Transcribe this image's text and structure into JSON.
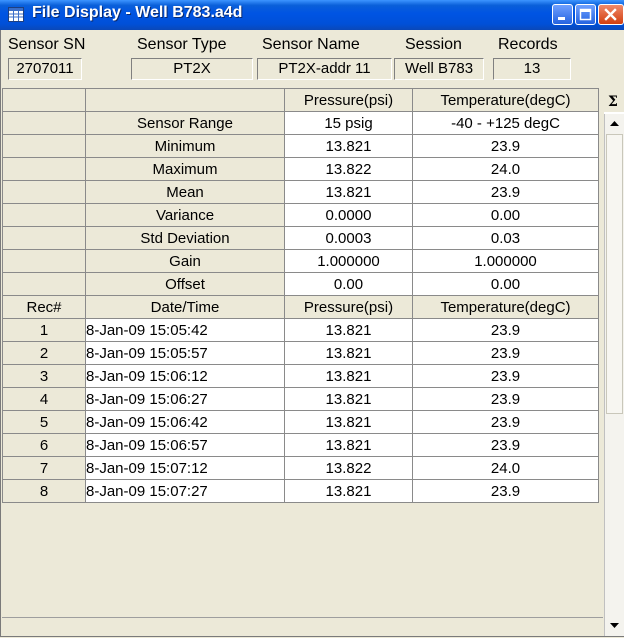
{
  "window": {
    "title": "File Display - Well B783.a4d",
    "icon": "grid-window-icon",
    "buttons": [
      "minimize-icon",
      "maximize-icon",
      "close-icon"
    ]
  },
  "header": {
    "labels": [
      "Sensor SN",
      "Sensor Type",
      "Sensor Name",
      "Session",
      "Records"
    ],
    "values": [
      "2707011",
      "PT2X",
      "PT2X-addr 11",
      "Well B783",
      "13"
    ],
    "sigma": "Σ"
  },
  "grid": {
    "columns": [
      "",
      "",
      "Pressure(psi)",
      "Temperature(degC)"
    ],
    "stats": [
      {
        "label": "Sensor Range",
        "pressure": "15 psig",
        "temperature": "-40 - +125 degC"
      },
      {
        "label": "Minimum",
        "pressure": "13.821",
        "temperature": "23.9"
      },
      {
        "label": "Maximum",
        "pressure": "13.822",
        "temperature": "24.0"
      },
      {
        "label": "Mean",
        "pressure": "13.821",
        "temperature": "23.9"
      },
      {
        "label": "Variance",
        "pressure": "0.0000",
        "temperature": "0.00"
      },
      {
        "label": "Std Deviation",
        "pressure": "0.0003",
        "temperature": "0.03"
      },
      {
        "label": "Gain",
        "pressure": "1.000000",
        "temperature": "1.000000"
      },
      {
        "label": "Offset",
        "pressure": "0.00",
        "temperature": "0.00"
      }
    ],
    "record_header": [
      "Rec#",
      "Date/Time",
      "Pressure(psi)",
      "Temperature(degC)"
    ],
    "records": [
      {
        "rec": "1",
        "datetime": "8-Jan-09 15:05:42",
        "pressure": "13.821",
        "temperature": "23.9"
      },
      {
        "rec": "2",
        "datetime": "8-Jan-09 15:05:57",
        "pressure": "13.821",
        "temperature": "23.9"
      },
      {
        "rec": "3",
        "datetime": "8-Jan-09 15:06:12",
        "pressure": "13.821",
        "temperature": "23.9"
      },
      {
        "rec": "4",
        "datetime": "8-Jan-09 15:06:27",
        "pressure": "13.821",
        "temperature": "23.9"
      },
      {
        "rec": "5",
        "datetime": "8-Jan-09 15:06:42",
        "pressure": "13.821",
        "temperature": "23.9"
      },
      {
        "rec": "6",
        "datetime": "8-Jan-09 15:06:57",
        "pressure": "13.821",
        "temperature": "23.9"
      },
      {
        "rec": "7",
        "datetime": "8-Jan-09 15:07:12",
        "pressure": "13.822",
        "temperature": "24.0"
      },
      {
        "rec": "8",
        "datetime": "8-Jan-09 15:07:27",
        "pressure": "13.821",
        "temperature": "23.9"
      }
    ]
  },
  "scrollbar": {
    "up_icon": "scroll-up-arrow-icon",
    "down_icon": "scroll-down-arrow-icon"
  },
  "colors": {
    "titlebar": "#0054e3",
    "window_bg": "#ece9d8",
    "close_button": "#d23f10",
    "cell_bg": "#ffffff"
  }
}
